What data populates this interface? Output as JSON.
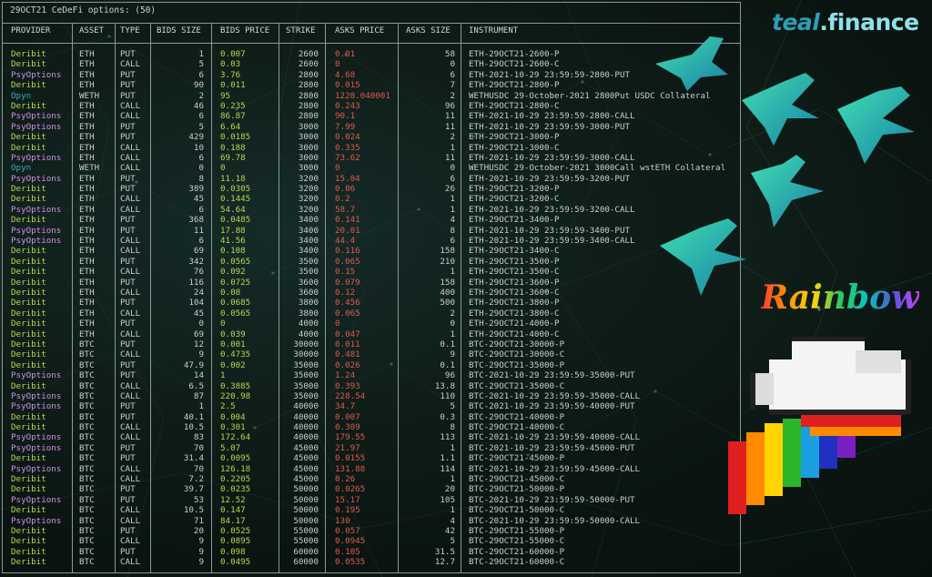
{
  "panel": {
    "title": "29OCT21 CeDeFi options: (50)"
  },
  "columns": [
    "PROVIDER",
    "ASSET",
    "TYPE",
    "BIDS SIZE",
    "BIDS PRICE",
    "STRIKE",
    "ASKS PRICE",
    "ASKS SIZE",
    "INSTRUMENT"
  ],
  "logo": {
    "main": "teal",
    "suffix": ".finance"
  },
  "rainbow_word": "Rainbow",
  "colors": {
    "bid": "#b6d84a",
    "ask": "#e0594b",
    "deribit": "#b6d84a",
    "psyoptions": "#d08fe8",
    "opyn": "#3da8c8"
  },
  "rows": [
    [
      "Deribit",
      "ETH",
      "PUT",
      "1",
      "0.007",
      "2600",
      "0.01",
      "58",
      "ETH-29OCT21-2600-P"
    ],
    [
      "Deribit",
      "ETH",
      "CALL",
      "5",
      "0.03",
      "2600",
      "0",
      "0",
      "ETH-29OCT21-2600-C"
    ],
    [
      "PsyOptions",
      "ETH",
      "PUT",
      "6",
      "3.76",
      "2800",
      "4.68",
      "6",
      "ETH-2021-10-29 23:59:59-2800-PUT"
    ],
    [
      "Deribit",
      "ETH",
      "PUT",
      "90",
      "0.011",
      "2800",
      "0.015",
      "7",
      "ETH-29OCT21-2800-P"
    ],
    [
      "Opyn",
      "WETH",
      "PUT",
      "2",
      "95",
      "2800",
      "1220.040001",
      "2",
      "WETHUSDC 29-October-2021 2800Put USDC Collateral"
    ],
    [
      "Deribit",
      "ETH",
      "CALL",
      "46",
      "0.235",
      "2800",
      "0.243",
      "96",
      "ETH-29OCT21-2800-C"
    ],
    [
      "PsyOptions",
      "ETH",
      "CALL",
      "6",
      "86.87",
      "2800",
      "90.1",
      "11",
      "ETH-2021-10-29 23:59:59-2800-CALL"
    ],
    [
      "PsyOptions",
      "ETH",
      "PUT",
      "5",
      "6.64",
      "3000",
      "7.99",
      "11",
      "ETH-2021-10-29 23:59:59-3000-PUT"
    ],
    [
      "Deribit",
      "ETH",
      "PUT",
      "429",
      "0.0185",
      "3000",
      "0.024",
      "2",
      "ETH-29OCT21-3000-P"
    ],
    [
      "Deribit",
      "ETH",
      "CALL",
      "10",
      "0.188",
      "3000",
      "0.335",
      "1",
      "ETH-29OCT21-3000-C"
    ],
    [
      "PsyOptions",
      "ETH",
      "CALL",
      "6",
      "69.78",
      "3000",
      "73.62",
      "11",
      "ETH-2021-10-29 23:59:59-3000-CALL"
    ],
    [
      "Opyn",
      "WETH",
      "CALL",
      "0",
      "0",
      "3000",
      "0",
      "0",
      "WETHUSDC 29-October-2021 3000Call wstETH Collateral"
    ],
    [
      "PsyOptions",
      "ETH",
      "PUT",
      "8",
      "11.18",
      "3200",
      "15.04",
      "6",
      "ETH-2021-10-29 23:59:59-3200-PUT"
    ],
    [
      "Deribit",
      "ETH",
      "PUT",
      "389",
      "0.0305",
      "3200",
      "0.06",
      "26",
      "ETH-29OCT21-3200-P"
    ],
    [
      "Deribit",
      "ETH",
      "CALL",
      "45",
      "0.1445",
      "3200",
      "0.2",
      "1",
      "ETH-29OCT21-3200-C"
    ],
    [
      "PsyOptions",
      "ETH",
      "CALL",
      "6",
      "54.64",
      "3200",
      "58.7",
      "1",
      "ETH-2021-10-29 23:59:59-3200-CALL"
    ],
    [
      "Deribit",
      "ETH",
      "PUT",
      "368",
      "0.0485",
      "3400",
      "0.141",
      "4",
      "ETH-29OCT21-3400-P"
    ],
    [
      "PsyOptions",
      "ETH",
      "PUT",
      "11",
      "17.88",
      "3400",
      "20.01",
      "8",
      "ETH-2021-10-29 23:59:59-3400-PUT"
    ],
    [
      "PsyOptions",
      "ETH",
      "CALL",
      "6",
      "41.56",
      "3400",
      "44.4",
      "6",
      "ETH-2021-10-29 23:59:59-3400-CALL"
    ],
    [
      "Deribit",
      "ETH",
      "CALL",
      "69",
      "0.108",
      "3400",
      "0.116",
      "158",
      "ETH-29OCT21-3400-C"
    ],
    [
      "Deribit",
      "ETH",
      "PUT",
      "342",
      "0.0565",
      "3500",
      "0.065",
      "210",
      "ETH-29OCT21-3500-P"
    ],
    [
      "Deribit",
      "ETH",
      "CALL",
      "76",
      "0.092",
      "3500",
      "0.15",
      "1",
      "ETH-29OCT21-3500-C"
    ],
    [
      "Deribit",
      "ETH",
      "PUT",
      "116",
      "0.0725",
      "3600",
      "0.079",
      "158",
      "ETH-29OCT21-3600-P"
    ],
    [
      "Deribit",
      "ETH",
      "CALL",
      "24",
      "0.08",
      "3600",
      "0.12",
      "400",
      "ETH-29OCT21-3600-C"
    ],
    [
      "Deribit",
      "ETH",
      "PUT",
      "104",
      "0.0685",
      "3800",
      "0.456",
      "500",
      "ETH-29OCT21-3800-P"
    ],
    [
      "Deribit",
      "ETH",
      "CALL",
      "45",
      "0.0565",
      "3800",
      "0.065",
      "2",
      "ETH-29OCT21-3800-C"
    ],
    [
      "Deribit",
      "ETH",
      "PUT",
      "0",
      "0",
      "4000",
      "0",
      "0",
      "ETH-29OCT21-4000-P"
    ],
    [
      "Deribit",
      "ETH",
      "CALL",
      "69",
      "0.039",
      "4000",
      "0.047",
      "1",
      "ETH-29OCT21-4000-C"
    ],
    [
      "Deribit",
      "BTC",
      "PUT",
      "12",
      "0.001",
      "30000",
      "0.011",
      "0.1",
      "BTC-29OCT21-30000-P"
    ],
    [
      "Deribit",
      "BTC",
      "CALL",
      "9",
      "0.4735",
      "30000",
      "0.481",
      "9",
      "BTC-29OCT21-30000-C"
    ],
    [
      "Deribit",
      "BTC",
      "PUT",
      "47.9",
      "0.002",
      "35000",
      "0.026",
      "0.1",
      "BTC-29OCT21-35000-P"
    ],
    [
      "PsyOptions",
      "BTC",
      "PUT",
      "14",
      "1",
      "35000",
      "1.24",
      "96",
      "BTC-2021-10-29 23:59:59-35000-PUT"
    ],
    [
      "Deribit",
      "BTC",
      "CALL",
      "6.5",
      "0.3885",
      "35000",
      "0.393",
      "13.8",
      "BTC-29OCT21-35000-C"
    ],
    [
      "PsyOptions",
      "BTC",
      "CALL",
      "87",
      "220.98",
      "35000",
      "228.54",
      "110",
      "BTC-2021-10-29 23:59:59-35000-CALL"
    ],
    [
      "PsyOptions",
      "BTC",
      "PUT",
      "1",
      "2.5",
      "40000",
      "34.7",
      "5",
      "BTC-2021-10-29 23:59:59-40000-PUT"
    ],
    [
      "Deribit",
      "BTC",
      "PUT",
      "40.1",
      "0.004",
      "40000",
      "0.007",
      "0.3",
      "BTC-29OCT21-40000-P"
    ],
    [
      "Deribit",
      "BTC",
      "CALL",
      "10.5",
      "0.301",
      "40000",
      "0.309",
      "8",
      "BTC-29OCT21-40000-C"
    ],
    [
      "PsyOptions",
      "BTC",
      "CALL",
      "83",
      "172.64",
      "40000",
      "179.55",
      "113",
      "BTC-2021-10-29 23:59:59-40000-CALL"
    ],
    [
      "PsyOptions",
      "BTC",
      "PUT",
      "70",
      "5.07",
      "45000",
      "21.97",
      "1",
      "BTC-2021-10-29 23:59:59-45000-PUT"
    ],
    [
      "Deribit",
      "BTC",
      "PUT",
      "31.4",
      "0.0095",
      "45000",
      "0.0155",
      "1.1",
      "BTC-29OCT21-45000-P"
    ],
    [
      "PsyOptions",
      "BTC",
      "CALL",
      "70",
      "126.18",
      "45000",
      "131.88",
      "114",
      "BTC-2021-10-29 23:59:59-45000-CALL"
    ],
    [
      "Deribit",
      "BTC",
      "CALL",
      "7.2",
      "0.2205",
      "45000",
      "0.26",
      "1",
      "BTC-29OCT21-45000-C"
    ],
    [
      "Deribit",
      "BTC",
      "PUT",
      "39.7",
      "0.0235",
      "50000",
      "0.0265",
      "20",
      "BTC-29OCT21-50000-P"
    ],
    [
      "PsyOptions",
      "BTC",
      "PUT",
      "53",
      "12.52",
      "50000",
      "15.17",
      "105",
      "BTC-2021-10-29 23:59:59-50000-PUT"
    ],
    [
      "Deribit",
      "BTC",
      "CALL",
      "10.5",
      "0.147",
      "50000",
      "0.195",
      "1",
      "BTC-29OCT21-50000-C"
    ],
    [
      "PsyOptions",
      "BTC",
      "CALL",
      "71",
      "84.17",
      "50000",
      "130",
      "4",
      "BTC-2021-10-29 23:59:59-50000-CALL"
    ],
    [
      "Deribit",
      "BTC",
      "PUT",
      "20",
      "0.0525",
      "55000",
      "0.057",
      "42",
      "BTC-29OCT21-55000-P"
    ],
    [
      "Deribit",
      "BTC",
      "CALL",
      "9",
      "0.0895",
      "55000",
      "0.0945",
      "5",
      "BTC-29OCT21-55000-C"
    ],
    [
      "Deribit",
      "BTC",
      "PUT",
      "9",
      "0.098",
      "60000",
      "0.105",
      "31.5",
      "BTC-29OCT21-60000-P"
    ],
    [
      "Deribit",
      "BTC",
      "CALL",
      "9",
      "0.0495",
      "60000",
      "0.0535",
      "12.7",
      "BTC-29OCT21-60000-C"
    ]
  ]
}
